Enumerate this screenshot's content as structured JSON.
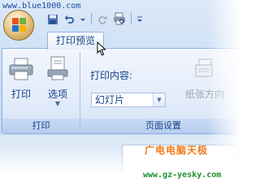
{
  "watermark": {
    "url": "www.blue1000.com",
    "brand_cn": "广电电脑天极",
    "site": "www.gz-yesky.com"
  },
  "tabs": [
    {
      "label": "打印预览",
      "active": true
    }
  ],
  "ribbon": {
    "groups": [
      {
        "label": "打印",
        "buttons": [
          {
            "label": "打印",
            "icon": "printer-icon"
          },
          {
            "label": "选项",
            "icon": "options-icon",
            "has_dropdown": true
          }
        ]
      },
      {
        "label": "页面设置",
        "print_content_label": "打印内容:",
        "print_content_value": "幻灯片",
        "orientation_label": "纸张方向",
        "orientation_enabled": false
      }
    ]
  },
  "colors": {
    "ribbon_text": "#15428b",
    "watermark_orange": "#f27a1a",
    "watermark_green": "#1d8f2c"
  }
}
